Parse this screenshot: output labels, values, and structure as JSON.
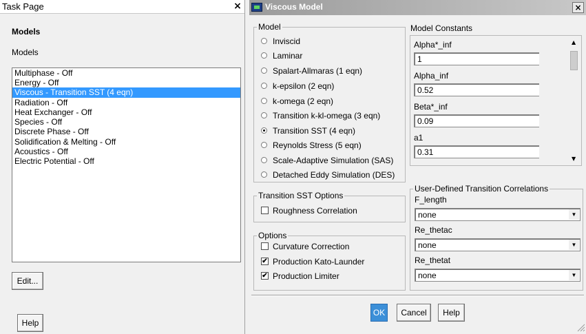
{
  "task_page": {
    "title": "Task Page",
    "close_glyph": "×",
    "heading": "Models",
    "list_label": "Models",
    "items": [
      {
        "label": "Multiphase - Off",
        "selected": false
      },
      {
        "label": "Energy - Off",
        "selected": false
      },
      {
        "label": "Viscous - Transition SST (4 eqn)",
        "selected": true
      },
      {
        "label": "Radiation - Off",
        "selected": false
      },
      {
        "label": "Heat Exchanger - Off",
        "selected": false
      },
      {
        "label": "Species - Off",
        "selected": false
      },
      {
        "label": "Discrete Phase - Off",
        "selected": false
      },
      {
        "label": "Solidification & Melting - Off",
        "selected": false
      },
      {
        "label": "Acoustics - Off",
        "selected": false
      },
      {
        "label": "Electric Potential - Off",
        "selected": false
      }
    ],
    "edit_label": "Edit...",
    "help_label": "Help"
  },
  "dialog": {
    "title": "Viscous Model",
    "close_glyph": "×",
    "model_group": {
      "legend": "Model",
      "options": [
        {
          "label": "Inviscid",
          "checked": false
        },
        {
          "label": "Laminar",
          "checked": false
        },
        {
          "label": "Spalart-Allmaras (1 eqn)",
          "checked": false
        },
        {
          "label": "k-epsilon (2 eqn)",
          "checked": false
        },
        {
          "label": "k-omega (2 eqn)",
          "checked": false
        },
        {
          "label": "Transition k-kl-omega (3 eqn)",
          "checked": false
        },
        {
          "label": "Transition SST (4 eqn)",
          "checked": true
        },
        {
          "label": "Reynolds Stress (5 eqn)",
          "checked": false
        },
        {
          "label": "Scale-Adaptive Simulation (SAS)",
          "checked": false
        },
        {
          "label": "Detached Eddy Simulation (DES)",
          "checked": false
        }
      ]
    },
    "tsst_options": {
      "legend": "Transition SST Options",
      "roughness_label": "Roughness Correlation",
      "roughness_checked": false
    },
    "options": {
      "legend": "Options",
      "items": [
        {
          "label": "Curvature Correction",
          "checked": false
        },
        {
          "label": "Production Kato-Launder",
          "checked": true
        },
        {
          "label": "Production Limiter",
          "checked": true
        }
      ]
    },
    "model_constants": {
      "label": "Model Constants",
      "items": [
        {
          "name": "Alpha*_inf",
          "value": "1"
        },
        {
          "name": "Alpha_inf",
          "value": "0.52"
        },
        {
          "name": "Beta*_inf",
          "value": "0.09"
        },
        {
          "name": "a1",
          "value": "0.31"
        }
      ]
    },
    "udtc": {
      "legend": "User-Defined Transition Correlations",
      "items": [
        {
          "name": "F_length",
          "value": "none"
        },
        {
          "name": "Re_thetac",
          "value": "none"
        },
        {
          "name": "Re_thetat",
          "value": "none"
        }
      ]
    },
    "ok_label": "OK",
    "cancel_label": "Cancel",
    "help_label": "Help"
  }
}
